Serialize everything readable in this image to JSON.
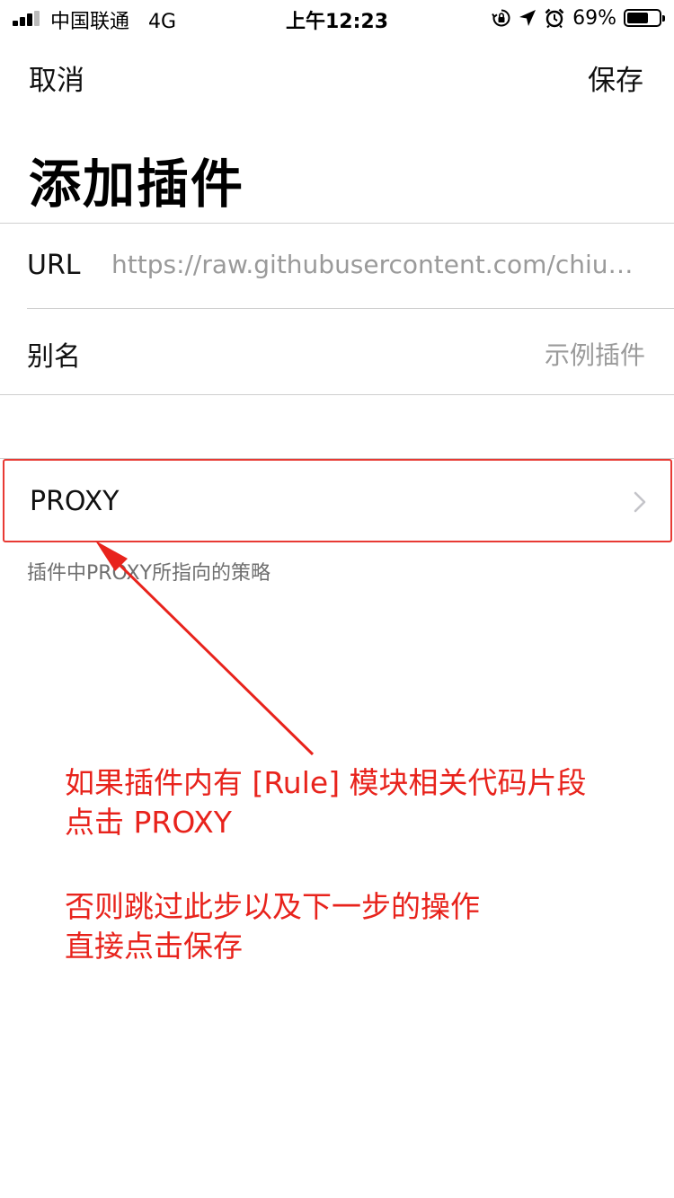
{
  "status": {
    "carrier": "中国联通",
    "network": "4G",
    "time": "上午12:23",
    "battery": "69%",
    "battery_level": 0.69,
    "icons": [
      "signal-icon",
      "orientation-lock-icon",
      "location-icon",
      "alarm-icon",
      "battery-icon"
    ]
  },
  "nav": {
    "cancel_label": "取消",
    "save_label": "保存"
  },
  "page": {
    "title": "添加插件"
  },
  "form": {
    "url_label": "URL",
    "url_value": "https://raw.githubusercontent.com/chiupa…",
    "alias_label": "别名",
    "alias_placeholder": "示例插件"
  },
  "proxy": {
    "label": "PROXY",
    "hint": "插件中PROXY所指向的策略"
  },
  "annotation": {
    "line1": "如果插件内有 [Rule] 模块相关代码片段",
    "line2": "点击 PROXY",
    "line3": "否则跳过此步以及下一步的操作",
    "line4": "直接点击保存"
  },
  "colors": {
    "annotation": "#e8231c",
    "highlight_border": "#e83a34",
    "placeholder": "#9a9a9a",
    "separator": "#cfcfcf"
  }
}
